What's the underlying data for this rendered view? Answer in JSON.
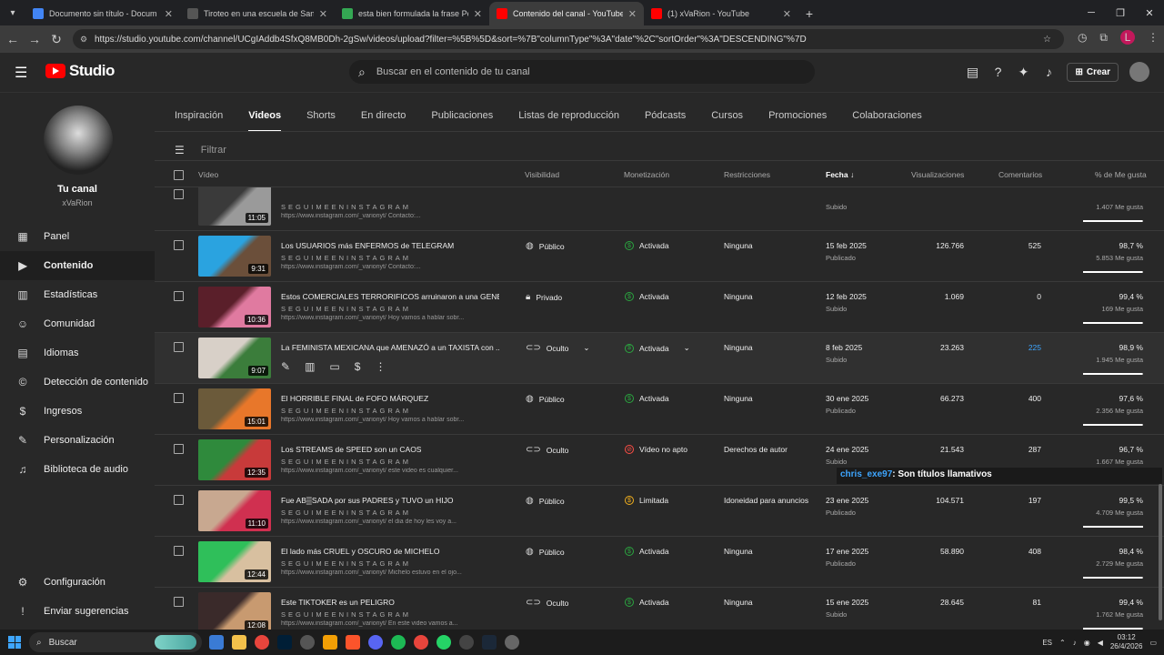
{
  "browser": {
    "tabs": [
      {
        "title": "Documento sin título - Docum",
        "color": "#4285f4"
      },
      {
        "title": "Tiroteo en una escuela de Sant",
        "color": "#555555"
      },
      {
        "title": "esta bien formulada la frase Po",
        "color": "#34a853"
      },
      {
        "title": "Contenido del canal - YouTube",
        "color": "#ff0000",
        "active": true
      },
      {
        "title": "(1) xVaRion - YouTube",
        "color": "#ff0000"
      }
    ],
    "url": "https://studio.youtube.com/channel/UCgIAddb4SfxQ8MB0Dh-2gSw/videos/upload?filter=%5B%5D&sort=%7B\"columnType\"%3A\"date\"%2C\"sortOrder\"%3A\"DESCENDING\"%7D",
    "profile_initial": "L"
  },
  "header": {
    "logo": "Studio",
    "search_placeholder": "Buscar en el contenido de tu canal",
    "create": "Crear"
  },
  "sidebar": {
    "title": "Tu canal",
    "name": "xVaRion",
    "items": [
      {
        "label": "Panel",
        "icon": "dashboard-icon",
        "glyph": "▦"
      },
      {
        "label": "Contenido",
        "icon": "content-icon",
        "glyph": "▶",
        "active": true
      },
      {
        "label": "Estadísticas",
        "icon": "analytics-icon",
        "glyph": "▥"
      },
      {
        "label": "Comunidad",
        "icon": "community-icon",
        "glyph": "☺"
      },
      {
        "label": "Idiomas",
        "icon": "subtitles-icon",
        "glyph": "▤"
      },
      {
        "label": "Detección de contenido",
        "icon": "copyright-icon",
        "glyph": "©"
      },
      {
        "label": "Ingresos",
        "icon": "earn-icon",
        "glyph": "$"
      },
      {
        "label": "Personalización",
        "icon": "customization-icon",
        "glyph": "✎"
      },
      {
        "label": "Biblioteca de audio",
        "icon": "audio-library-icon",
        "glyph": "♫"
      }
    ],
    "bottom": [
      {
        "label": "Configuración",
        "icon": "settings-icon",
        "glyph": "⚙"
      },
      {
        "label": "Enviar sugerencias",
        "icon": "feedback-icon",
        "glyph": "!"
      }
    ]
  },
  "content_tabs": [
    "Inspiración",
    "Videos",
    "Shorts",
    "En directo",
    "Publicaciones",
    "Listas de reproducción",
    "Pódcasts",
    "Cursos",
    "Promociones",
    "Colaboraciones"
  ],
  "active_tab": "Videos",
  "filter_label": "Filtrar",
  "columns": {
    "video": "Vídeo",
    "visibility": "Visibilidad",
    "monetization": "Monetización",
    "restrictions": "Restricciones",
    "date": "Fecha",
    "views": "Visualizaciones",
    "comments": "Comentarios",
    "likes": "% de Me gusta"
  },
  "rows": [
    {
      "title": "",
      "sub": "SEGUIMEENINSTAGRAM",
      "desc": "https://www.instagram.com/_varionyt/ Contacto:...",
      "duration": "11:05",
      "visibility": "",
      "vis_icon": "",
      "monetization": "",
      "mon_icon": "",
      "restrictions": "",
      "date": "",
      "date_sub": "Subido",
      "views": "",
      "comments": "",
      "likes": "",
      "likes_sub": "1.407 Me gusta",
      "like_frac": 0.98,
      "thumb": [
        "#3a3a3a",
        "#9a9a9a"
      ]
    },
    {
      "title": "Los USUARIOS más ENFERMOS de TELEGRAM",
      "sub": "SEGUIMEENINSTAGRAM",
      "desc": "https://www.instagram.com/_varionyt/ Contacto:...",
      "duration": "9:31",
      "visibility": "Público",
      "vis_icon": "globe",
      "monetization": "Activada",
      "mon_icon": "green",
      "restrictions": "Ninguna",
      "date": "15 feb 2025",
      "date_sub": "Publicado",
      "views": "126.766",
      "comments": "525",
      "likes": "98,7 %",
      "likes_sub": "5.853 Me gusta",
      "like_frac": 0.987,
      "thumb": [
        "#2aa3e0",
        "#6b4f3a"
      ]
    },
    {
      "title": "Estos COMERCIALES TERRORIFICOS arruinaron a una GENE...",
      "sub": "SEGUIMEENINSTAGRAM",
      "desc": "https://www.instagram.com/_varionyt/ Hoy vamos a hablar sobr...",
      "duration": "10:36",
      "visibility": "Privado",
      "vis_icon": "lock",
      "monetization": "Activada",
      "mon_icon": "green",
      "restrictions": "Ninguna",
      "date": "12 feb 2025",
      "date_sub": "Subido",
      "views": "1.069",
      "comments": "0",
      "likes": "99,4 %",
      "likes_sub": "169 Me gusta",
      "like_frac": 0.994,
      "thumb": [
        "#5a1f2a",
        "#e07aa0"
      ]
    },
    {
      "title": "La FEMINISTA MEXICANA que AMENAZÓ a un TAXISTA con ...",
      "sub": "",
      "desc": "",
      "duration": "9:07",
      "visibility": "Oculto",
      "vis_icon": "link",
      "vis_dropdown": true,
      "monetization": "Activada",
      "mon_icon": "green",
      "mon_dropdown": true,
      "restrictions": "Ninguna",
      "date": "8 feb 2025",
      "date_sub": "Subido",
      "views": "23.263",
      "comments": "225",
      "comments_link": true,
      "likes": "98,9 %",
      "likes_sub": "1.945 Me gusta",
      "like_frac": 0.989,
      "thumb": [
        "#d8d0c8",
        "#3b7d3b"
      ],
      "hover": true
    },
    {
      "title": "El HORRIBLE FINAL de FOFO MÁRQUEZ",
      "sub": "SEGUIMEENINSTAGRAM",
      "desc": "https://www.instagram.com/_varionyt/ Hoy vamos a hablar sobr...",
      "duration": "15:01",
      "visibility": "Público",
      "vis_icon": "globe",
      "monetization": "Activada",
      "mon_icon": "green",
      "restrictions": "Ninguna",
      "date": "30 ene 2025",
      "date_sub": "Publicado",
      "views": "66.273",
      "comments": "400",
      "likes": "97,6 %",
      "likes_sub": "2.356 Me gusta",
      "like_frac": 0.976,
      "thumb": [
        "#6b5a3a",
        "#e8772a"
      ]
    },
    {
      "title": "Los STREAMS de SPEED son un CAOS",
      "sub": "SEGUIMEENINSTAGRAM",
      "desc": "https://www.instagram.com/_varionyt/ este video es cualquier...",
      "duration": "12:35",
      "visibility": "Oculto",
      "vis_icon": "link",
      "monetization": "Vídeo no apto",
      "mon_icon": "red",
      "restrictions": "Derechos de autor",
      "date": "24 ene 2025",
      "date_sub": "Subido",
      "views": "21.543",
      "comments": "287",
      "likes": "96,7 %",
      "likes_sub": "1.667 Me gusta",
      "like_frac": 0.967,
      "thumb": [
        "#2f8a3c",
        "#c83a3a"
      ]
    },
    {
      "title": "Fue AB▒SADA por sus PADRES y TUVO un HIJO",
      "sub": "SEGUIMEENINSTAGRAM",
      "desc": "https://www.instagram.com/_varionyt/ el dia de hoy les voy a...",
      "duration": "11:10",
      "visibility": "Público",
      "vis_icon": "globe",
      "monetization": "Limitada",
      "mon_icon": "yellow",
      "restrictions": "Idoneidad para anuncios",
      "date": "23 ene 2025",
      "date_sub": "Publicado",
      "views": "104.571",
      "comments": "197",
      "likes": "99,5 %",
      "likes_sub": "4.709 Me gusta",
      "like_frac": 0.995,
      "thumb": [
        "#c8a890",
        "#d03050"
      ]
    },
    {
      "title": "El lado más CRUEL y OSCURO de MICHELO",
      "sub": "SEGUIMEENINSTAGRAM",
      "desc": "https://www.instagram.com/_varionyt/ Michelo estuvo en el ojo...",
      "duration": "12:44",
      "visibility": "Público",
      "vis_icon": "globe",
      "monetization": "Activada",
      "mon_icon": "green",
      "restrictions": "Ninguna",
      "date": "17 ene 2025",
      "date_sub": "Publicado",
      "views": "58.890",
      "comments": "408",
      "likes": "98,4 %",
      "likes_sub": "2.729 Me gusta",
      "like_frac": 0.984,
      "thumb": [
        "#2fbf5a",
        "#d8c0a0"
      ]
    },
    {
      "title": "Este TIKTOKER es un PELIGRO",
      "sub": "SEGUIMEENINSTAGRAM",
      "desc": "https://www.instagram.com/_varionyt/ En este video vamos a...",
      "duration": "12:08",
      "visibility": "Oculto",
      "vis_icon": "link",
      "monetization": "Activada",
      "mon_icon": "green",
      "restrictions": "Ninguna",
      "date": "15 ene 2025",
      "date_sub": "Subido",
      "views": "28.645",
      "comments": "81",
      "likes": "99,4 %",
      "likes_sub": "1.762 Me gusta",
      "like_frac": 0.994,
      "thumb": [
        "#3a2a2a",
        "#c89a70"
      ]
    }
  ],
  "chat_overlay": {
    "user": "chris_exe97",
    "message": ": Son títulos llamativos"
  },
  "taskbar": {
    "search": "Buscar",
    "lang": "ES",
    "time": "03:12",
    "date": "26/4/2026"
  }
}
